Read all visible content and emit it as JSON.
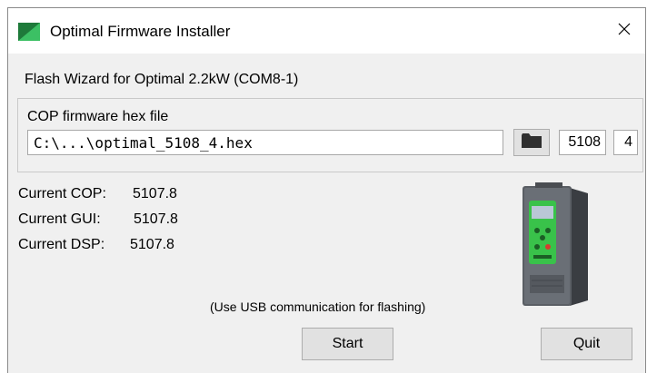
{
  "window": {
    "title": "Optimal Firmware Installer",
    "close_glyph": "✕",
    "icon": "app-logo-green-triangle-icon"
  },
  "wizard": {
    "heading": "Flash Wizard for Optimal 2.2kW (COM8-1)"
  },
  "firmware_group": {
    "label": "COP firmware hex file",
    "file_path": "C:\\...\\optimal_5108_4.hex",
    "browse_icon": "folder-icon",
    "version_major": "5108",
    "version_minor": "4"
  },
  "current_versions": [
    {
      "label": "Current COP:",
      "value": "5107.8"
    },
    {
      "label": "Current GUI:",
      "value": "5107.8"
    },
    {
      "label": "Current DSP:",
      "value": "5107.8"
    }
  ],
  "note": "(Use USB communication for flashing)",
  "buttons": {
    "start": "Start",
    "quit": "Quit"
  },
  "colors": {
    "logo_dark_green": "#1e7a3a",
    "logo_light_green": "#3cc064",
    "window_bg": "#f0f0f0",
    "device_screen_green": "#39c24a"
  }
}
